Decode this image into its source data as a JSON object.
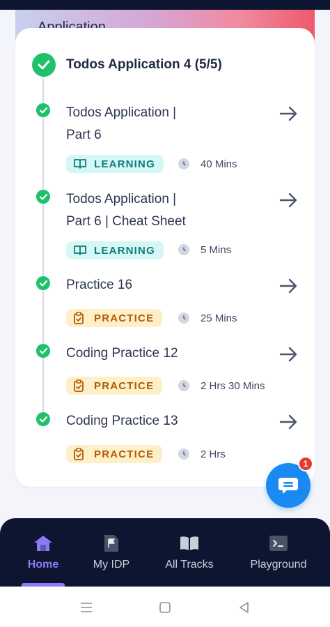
{
  "hero": {
    "title": "Application"
  },
  "module": {
    "title": "Todos Application 4 (5/5)"
  },
  "items": [
    {
      "title_line1": "Todos Application |",
      "title_line2": "Part 6",
      "type": "LEARNING",
      "duration": "40 Mins"
    },
    {
      "title_line1": "Todos Application |",
      "title_line2": "Part 6 | Cheat Sheet",
      "type": "LEARNING",
      "duration": "5 Mins"
    },
    {
      "title_line1": "Practice 16",
      "title_line2": "",
      "type": "PRACTICE",
      "duration": "25 Mins"
    },
    {
      "title_line1": "Coding Practice 12",
      "title_line2": "",
      "type": "PRACTICE",
      "duration": "2 Hrs 30 Mins"
    },
    {
      "title_line1": "Coding Practice 13",
      "title_line2": "",
      "type": "PRACTICE",
      "duration": "2 Hrs"
    }
  ],
  "chat": {
    "badge_count": "1",
    "icon": "chat-bubble-icon"
  },
  "nav": {
    "home": "Home",
    "idp": "My IDP",
    "tracks": "All Tracks",
    "playground": "Playground"
  },
  "colors": {
    "success": "#1fc16b",
    "accent": "#8b7cf6",
    "nav_bg": "#0d1530",
    "fab": "#1a8af2",
    "learning_bg": "#d5f7f5",
    "learning_fg": "#0f7c7a",
    "practice_bg": "#fdf0c8",
    "practice_fg": "#b05a05"
  }
}
